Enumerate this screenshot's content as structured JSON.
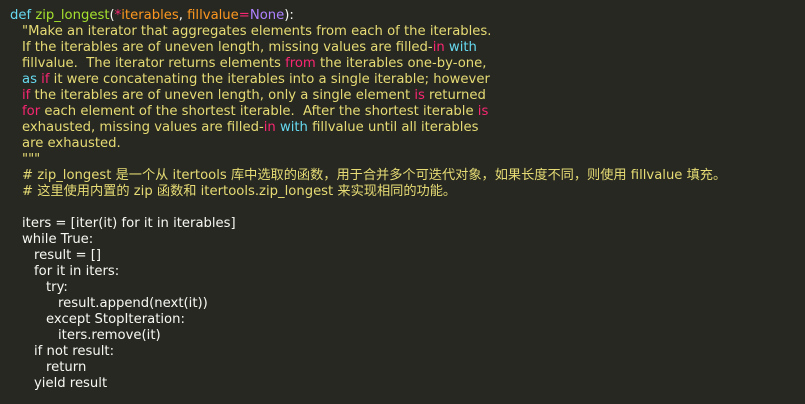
{
  "colors": {
    "background": "#272822",
    "text": "#f8f8f2",
    "keyword": "#66d9ef",
    "function_name": "#a6e22e",
    "parameter": "#fd971f",
    "operator": "#f92672",
    "constant": "#ae81ff",
    "string": "#e6db74",
    "comment": "#e6db74"
  },
  "code_lines": [
    {
      "indent": 0,
      "tokens": [
        {
          "t": "kw",
          "v": "def "
        },
        {
          "t": "fn",
          "v": "zip_longest"
        },
        {
          "t": "plain",
          "v": "("
        },
        {
          "t": "op",
          "v": "*"
        },
        {
          "t": "param",
          "v": "iterables"
        },
        {
          "t": "plain",
          "v": ", "
        },
        {
          "t": "param",
          "v": "fillvalue"
        },
        {
          "t": "op",
          "v": "="
        },
        {
          "t": "const",
          "v": "None"
        },
        {
          "t": "plain",
          "v": "):"
        }
      ]
    },
    {
      "indent": 1,
      "tokens": [
        {
          "t": "str",
          "v": "\"Make an iterator that aggregates elements from each of the iterables."
        }
      ]
    },
    {
      "indent": 1,
      "tokens": [
        {
          "t": "str",
          "v": "If the iterables are of uneven length, missing values are filled-"
        },
        {
          "t": "pink",
          "v": "in "
        },
        {
          "t": "blue",
          "v": "with"
        }
      ]
    },
    {
      "indent": 1,
      "tokens": [
        {
          "t": "str",
          "v": "fillvalue.  The iterator returns elements "
        },
        {
          "t": "pink",
          "v": "from"
        },
        {
          "t": "str",
          "v": " the iterables one-by-one,"
        }
      ]
    },
    {
      "indent": 1,
      "tokens": [
        {
          "t": "blue",
          "v": "as "
        },
        {
          "t": "pink",
          "v": "if"
        },
        {
          "t": "str",
          "v": " it were concatenating the iterables into a single iterable; however"
        }
      ]
    },
    {
      "indent": 1,
      "tokens": [
        {
          "t": "pink",
          "v": "if"
        },
        {
          "t": "str",
          "v": " the iterables are of uneven length, only a single element "
        },
        {
          "t": "pink",
          "v": "is"
        },
        {
          "t": "str",
          "v": " returned"
        }
      ]
    },
    {
      "indent": 1,
      "tokens": [
        {
          "t": "pink",
          "v": "for"
        },
        {
          "t": "str",
          "v": " each element of the shortest iterable.  After the shortest iterable "
        },
        {
          "t": "pink",
          "v": "is"
        }
      ]
    },
    {
      "indent": 1,
      "tokens": [
        {
          "t": "str",
          "v": "exhausted, missing values are filled-"
        },
        {
          "t": "pink",
          "v": "in "
        },
        {
          "t": "blue",
          "v": "with"
        },
        {
          "t": "str",
          "v": " fillvalue until all iterables"
        }
      ]
    },
    {
      "indent": 1,
      "tokens": [
        {
          "t": "str",
          "v": "are exhausted."
        }
      ]
    },
    {
      "indent": 1,
      "tokens": [
        {
          "t": "str",
          "v": "\"\"\""
        }
      ]
    },
    {
      "indent": 1,
      "tokens": [
        {
          "t": "com",
          "v": "# zip_longest 是一个从 itertools 库中选取的函数，用于合并多个可迭代对象，如果长度不同，则使用 fillvalue 填充。"
        }
      ]
    },
    {
      "indent": 1,
      "tokens": [
        {
          "t": "com",
          "v": "# 这里使用内置的 zip 函数和 itertools.zip_longest 来实现相同的功能。"
        }
      ]
    },
    {
      "indent": 0,
      "tokens": []
    },
    {
      "indent": 1,
      "tokens": [
        {
          "t": "plain",
          "v": "iters = [iter(it) for it in iterables]"
        }
      ]
    },
    {
      "indent": 1,
      "tokens": [
        {
          "t": "plain",
          "v": "while True:"
        }
      ]
    },
    {
      "indent": 2,
      "tokens": [
        {
          "t": "plain",
          "v": "result = []"
        }
      ]
    },
    {
      "indent": 2,
      "tokens": [
        {
          "t": "plain",
          "v": "for it in iters:"
        }
      ]
    },
    {
      "indent": 3,
      "tokens": [
        {
          "t": "plain",
          "v": "try:"
        }
      ]
    },
    {
      "indent": 4,
      "tokens": [
        {
          "t": "plain",
          "v": "result.append(next(it))"
        }
      ]
    },
    {
      "indent": 3,
      "tokens": [
        {
          "t": "plain",
          "v": "except StopIteration:"
        }
      ]
    },
    {
      "indent": 4,
      "tokens": [
        {
          "t": "plain",
          "v": "iters.remove(it)"
        }
      ]
    },
    {
      "indent": 2,
      "tokens": [
        {
          "t": "plain",
          "v": "if not result:"
        }
      ]
    },
    {
      "indent": 3,
      "tokens": [
        {
          "t": "plain",
          "v": "return"
        }
      ]
    },
    {
      "indent": 2,
      "tokens": [
        {
          "t": "plain",
          "v": "yield result"
        }
      ]
    }
  ]
}
